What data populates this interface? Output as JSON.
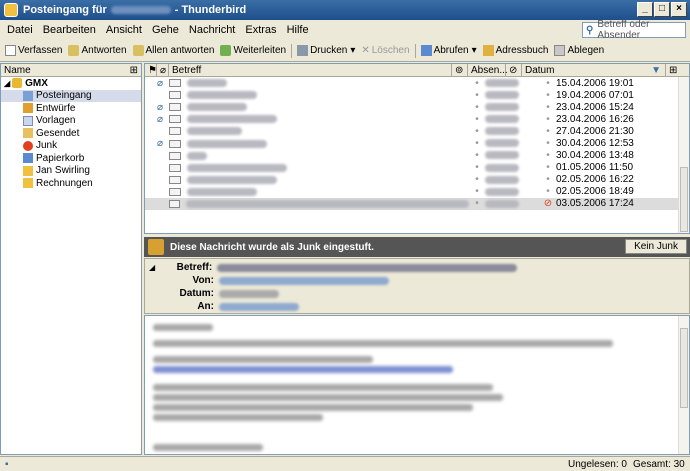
{
  "window": {
    "title_prefix": "Posteingang für",
    "title_suffix": "- Thunderbird",
    "min_label": "_",
    "max_label": "□",
    "close_label": "×"
  },
  "menubar": [
    "Datei",
    "Bearbeiten",
    "Ansicht",
    "Gehe",
    "Nachricht",
    "Extras",
    "Hilfe"
  ],
  "search": {
    "placeholder": "Betreff oder Absender"
  },
  "toolbar": {
    "compose": "Verfassen",
    "reply": "Antworten",
    "reply_all": "Allen antworten",
    "forward": "Weiterleiten",
    "print": "Drucken",
    "delete": "Löschen",
    "get_mail": "Abrufen",
    "address_book": "Adressbuch",
    "file": "Ablegen"
  },
  "folders": {
    "header": "Name",
    "account": "GMX",
    "items": [
      "Posteingang",
      "Entwürfe",
      "Vorlagen",
      "Gesendet",
      "Junk",
      "Papierkorb",
      "Jan Swirling",
      "Rechnungen"
    ],
    "selected_index": 0
  },
  "columns": {
    "subject": "Betreff",
    "sender": "Absen...",
    "date": "Datum"
  },
  "messages": [
    {
      "date": "15.04.2006 19:01",
      "attach": true,
      "junk": false
    },
    {
      "date": "19.04.2006 07:01",
      "attach": false,
      "junk": false
    },
    {
      "date": "23.04.2006 15:24",
      "attach": true,
      "junk": false
    },
    {
      "date": "23.04.2006 16:26",
      "attach": true,
      "junk": false
    },
    {
      "date": "27.04.2006 21:30",
      "attach": false,
      "junk": false
    },
    {
      "date": "30.04.2006 12:53",
      "attach": true,
      "junk": false
    },
    {
      "date": "30.04.2006 13:48",
      "attach": false,
      "junk": false
    },
    {
      "date": "01.05.2006 11:50",
      "attach": false,
      "junk": false
    },
    {
      "date": "02.05.2006 16:22",
      "attach": false,
      "junk": false
    },
    {
      "date": "02.05.2006 18:49",
      "attach": false,
      "junk": false
    },
    {
      "date": "03.05.2006 17:24",
      "attach": false,
      "junk": true
    }
  ],
  "junk_notice": {
    "text": "Diese Nachricht wurde als Junk eingestuft.",
    "button": "Kein Junk"
  },
  "header": {
    "subject_label": "Betreff:",
    "from_label": "Von:",
    "date_label": "Datum:",
    "to_label": "An:"
  },
  "status": {
    "unread": "Ungelesen: 0",
    "total": "Gesamt: 30"
  }
}
